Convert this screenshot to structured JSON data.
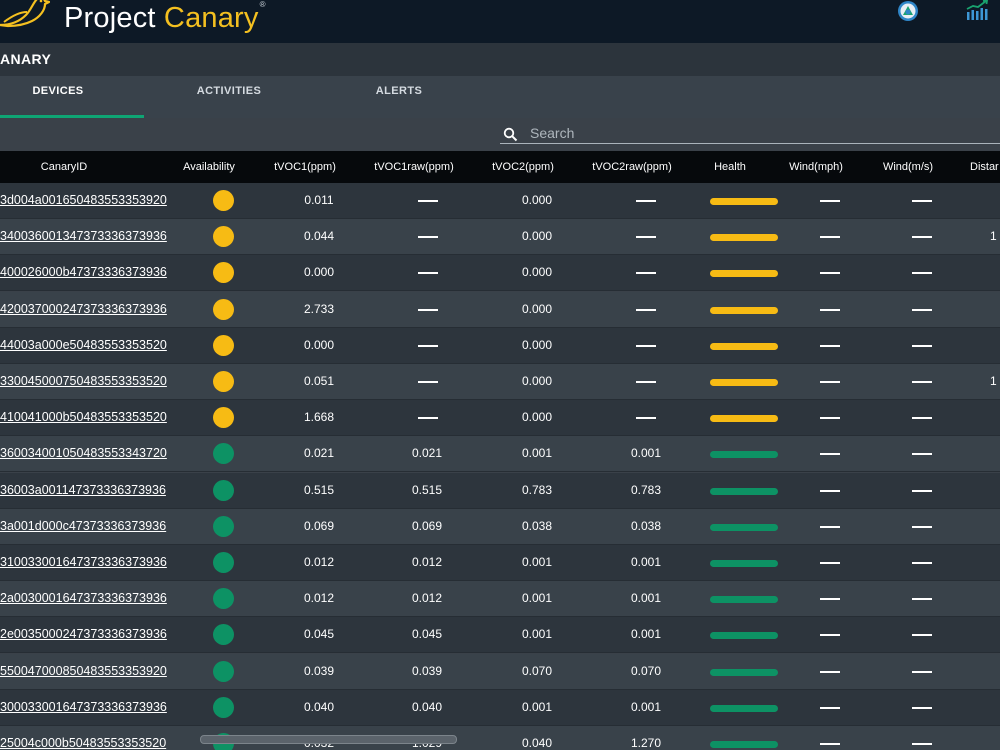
{
  "app": {
    "brand_prefix": "Project ",
    "brand_accent": "Canary",
    "brand_mark": "®",
    "accent_color": "#f4c020"
  },
  "icons": {
    "logo": "canary-bird-logo",
    "user": "user-avatar-icon",
    "chart": "bar-chart-icon",
    "search": "search-icon"
  },
  "org": {
    "title": "ANARY"
  },
  "tabs": [
    {
      "label": "DEVICES",
      "active": true
    },
    {
      "label": "ACTIVITIES",
      "active": false
    },
    {
      "label": "ALERTS",
      "active": false
    }
  ],
  "search": {
    "placeholder": "Search",
    "value": ""
  },
  "table": {
    "status_colors": {
      "yellow": "#f7bb14",
      "green": "#0d9264"
    },
    "columns": [
      "CanaryID",
      "Availability",
      "tVOC1(ppm)",
      "tVOC1raw(ppm)",
      "tVOC2(ppm)",
      "tVOC2raw(ppm)",
      "Health",
      "Wind(mph)",
      "Wind(m/s)",
      "Distar"
    ],
    "rows": [
      {
        "id": "3d004a001650483553353920",
        "status": "yellow",
        "tvoc1": "0.011",
        "tvoc1raw": "",
        "tvoc2": "0.000",
        "tvoc2raw": "",
        "distance": ""
      },
      {
        "id": "340036001347373336373936",
        "status": "yellow",
        "tvoc1": "0.044",
        "tvoc1raw": "",
        "tvoc2": "0.000",
        "tvoc2raw": "",
        "distance": "1"
      },
      {
        "id": "400026000b47373336373936",
        "status": "yellow",
        "tvoc1": "0.000",
        "tvoc1raw": "",
        "tvoc2": "0.000",
        "tvoc2raw": "",
        "distance": ""
      },
      {
        "id": "420037000247373336373936",
        "status": "yellow",
        "tvoc1": "2.733",
        "tvoc1raw": "",
        "tvoc2": "0.000",
        "tvoc2raw": "",
        "distance": ""
      },
      {
        "id": "44003a000e50483553353520",
        "status": "yellow",
        "tvoc1": "0.000",
        "tvoc1raw": "",
        "tvoc2": "0.000",
        "tvoc2raw": "",
        "distance": ""
      },
      {
        "id": "330045000750483553353520",
        "status": "yellow",
        "tvoc1": "0.051",
        "tvoc1raw": "",
        "tvoc2": "0.000",
        "tvoc2raw": "",
        "distance": "1"
      },
      {
        "id": "410041000b50483553353520",
        "status": "yellow",
        "tvoc1": "1.668",
        "tvoc1raw": "",
        "tvoc2": "0.000",
        "tvoc2raw": "",
        "distance": ""
      },
      {
        "id": "360034001050483553343720",
        "status": "green",
        "tvoc1": "0.021",
        "tvoc1raw": "0.021",
        "tvoc2": "0.001",
        "tvoc2raw": "0.001",
        "distance": ""
      },
      {
        "id": "36003a001147373336373936",
        "status": "green",
        "tvoc1": "0.515",
        "tvoc1raw": "0.515",
        "tvoc2": "0.783",
        "tvoc2raw": "0.783",
        "distance": ""
      },
      {
        "id": "3a001d000c47373336373936",
        "status": "green",
        "tvoc1": "0.069",
        "tvoc1raw": "0.069",
        "tvoc2": "0.038",
        "tvoc2raw": "0.038",
        "distance": ""
      },
      {
        "id": "310033001647373336373936",
        "status": "green",
        "tvoc1": "0.012",
        "tvoc1raw": "0.012",
        "tvoc2": "0.001",
        "tvoc2raw": "0.001",
        "distance": ""
      },
      {
        "id": "2a0030001647373336373936",
        "status": "green",
        "tvoc1": "0.012",
        "tvoc1raw": "0.012",
        "tvoc2": "0.001",
        "tvoc2raw": "0.001",
        "distance": ""
      },
      {
        "id": "2e0035000247373336373936",
        "status": "green",
        "tvoc1": "0.045",
        "tvoc1raw": "0.045",
        "tvoc2": "0.001",
        "tvoc2raw": "0.001",
        "distance": ""
      },
      {
        "id": "550047000850483553353920",
        "status": "green",
        "tvoc1": "0.039",
        "tvoc1raw": "0.039",
        "tvoc2": "0.070",
        "tvoc2raw": "0.070",
        "distance": ""
      },
      {
        "id": "300033001647373336373936",
        "status": "green",
        "tvoc1": "0.040",
        "tvoc1raw": "0.040",
        "tvoc2": "0.001",
        "tvoc2raw": "0.001",
        "distance": ""
      },
      {
        "id": "25004c000b50483553353520",
        "status": "green",
        "tvoc1": "0.032",
        "tvoc1raw": "1.029",
        "tvoc2": "0.040",
        "tvoc2raw": "1.270",
        "distance": ""
      }
    ]
  }
}
